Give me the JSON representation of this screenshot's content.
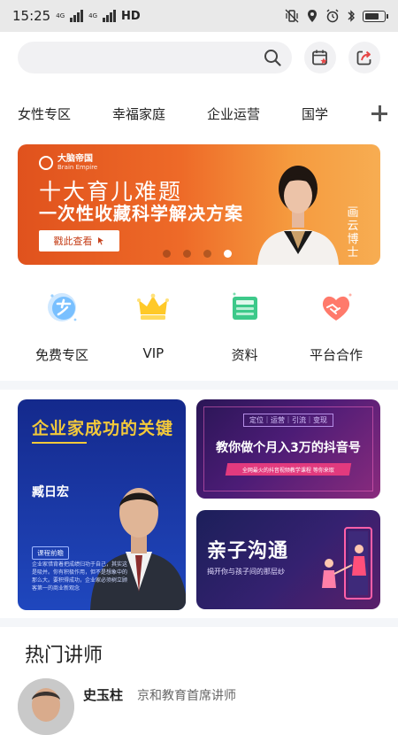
{
  "status_bar": {
    "time": "15:25",
    "network_1": "4G",
    "network_2": "4G",
    "hd_label": "HD",
    "battery_level": 0.8
  },
  "search": {
    "placeholder": "",
    "icons": [
      "search-icon",
      "calendar-star-icon",
      "share-icon"
    ]
  },
  "categories": {
    "items": [
      "女性专区",
      "幸福家庭",
      "企业运营",
      "国学"
    ],
    "add_icon": "plus-icon"
  },
  "banner": {
    "logo_cn": "大脑帝国",
    "logo_en": "Brain Empire",
    "title": "十大育儿难题",
    "subtitle": "一次性收藏科学解决方案",
    "cta": "戳此查看",
    "vertical_text": "画云博士",
    "dots": 4,
    "active_dot": 4,
    "colors": {
      "start": "#e0521d",
      "end": "#f7ad52"
    }
  },
  "quick_links": [
    {
      "label": "免费专区",
      "icon": "free-zone-icon"
    },
    {
      "label": "VIP",
      "icon": "crown-icon"
    },
    {
      "label": "资料",
      "icon": "document-icon"
    },
    {
      "label": "平台合作",
      "icon": "handshake-heart-icon"
    }
  ],
  "promos": {
    "left": {
      "title": "企业家成功的关键",
      "name": "臧日宏",
      "tag": "课程前瞻",
      "desc": "企业家惜背着把成绩归功于自己，其实这是吸并。你有积极作用，但不是想象中的那么大。要积得成功，企业家必须树立顾客第一的商业新观念"
    },
    "top_right": {
      "tags": "定位｜运营｜引流｜变现",
      "title": "教你做个月入3万的抖音号",
      "strip": "全网最火的抖音视频教学课程 等你来取"
    },
    "bottom_right": {
      "title": "亲子沟通",
      "subtitle": "揭开你与孩子间的那层纱"
    }
  },
  "hot_teachers": {
    "section_title": "热门讲师",
    "items": [
      {
        "name": "史玉柱",
        "title": "京和教育首席讲师"
      }
    ]
  }
}
